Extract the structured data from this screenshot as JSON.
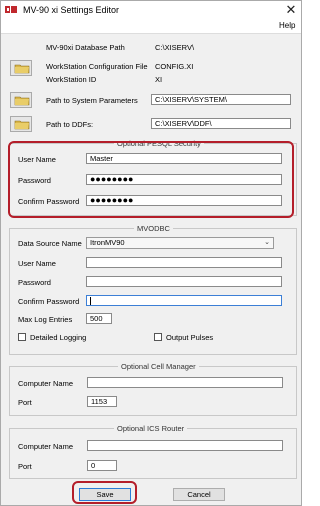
{
  "window": {
    "title": "MV-90 xi Settings Editor",
    "close_glyph": "✕"
  },
  "menu": {
    "help_label": "Help"
  },
  "paths": {
    "db_path_label": "MV-90xi Database Path",
    "db_path_value": "C:\\XISERV\\",
    "ws_config_label": "WorkStation Configuration File",
    "ws_config_value": "CONFIG.XI",
    "ws_id_label": "WorkStation ID",
    "ws_id_value": "XI",
    "sys_params_label": "Path to System Parameters",
    "sys_params_value": "C:\\XISERV\\SYSTEM\\",
    "ddfs_label": "Path to DDFs:",
    "ddfs_value": "C:\\XISERV\\DDF\\"
  },
  "pesql": {
    "title": "Optional PESQL Security",
    "username_label": "User Name",
    "username_value": "Master",
    "password_label": "Password",
    "password_value": "●●●●●●●●",
    "confirm_label": "Confirm Password",
    "confirm_value": "●●●●●●●●"
  },
  "mvodbc": {
    "title": "MVODBC",
    "dsn_label": "Data Source Name",
    "dsn_value": "ItronMV90",
    "username_label": "User Name",
    "username_value": "",
    "password_label": "Password",
    "password_value": "",
    "confirm_label": "Confirm Password",
    "confirm_value": "",
    "max_log_label": "Max Log Entries",
    "max_log_value": "500",
    "detailed_logging_label": "Detailed Logging",
    "output_pulses_label": "Output Pulses"
  },
  "cell_manager": {
    "title": "Optional Cell Manager",
    "computer_label": "Computer Name",
    "computer_value": "",
    "port_label": "Port",
    "port_value": "1153"
  },
  "ics_router": {
    "title": "Optional ICS Router",
    "computer_label": "Computer Name",
    "computer_value": "",
    "port_label": "Port",
    "port_value": "0"
  },
  "buttons": {
    "save_label": "Save",
    "cancel_label": "Cancel"
  },
  "colors": {
    "highlight": "#b41e2a",
    "focus_border": "#3c7fd6",
    "folder_icon": "#d9b64a"
  }
}
